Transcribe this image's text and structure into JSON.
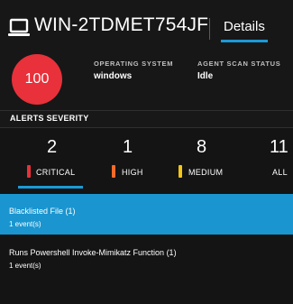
{
  "header": {
    "host_icon": "laptop-icon",
    "hostname": "WIN-2TDMET754JF",
    "details_tab": "Details",
    "risk_score": "100",
    "os_label": "OPERATING SYSTEM",
    "os_value": "windows",
    "scan_label": "AGENT SCAN STATUS",
    "scan_value": "Idle"
  },
  "severity": {
    "title": "ALERTS SEVERITY",
    "items": [
      {
        "count": "2",
        "label": "CRITICAL",
        "color": "#e8313a"
      },
      {
        "count": "1",
        "label": "HIGH",
        "color": "#f36a2b"
      },
      {
        "count": "8",
        "label": "MEDIUM",
        "color": "#f5c518"
      },
      {
        "count": "11",
        "label": "ALL",
        "color": ""
      }
    ],
    "selected": "CRITICAL"
  },
  "alerts": [
    {
      "title": "Blacklisted File (1)",
      "events": "1 event(s)",
      "selected": true
    },
    {
      "title": "Runs Powershell Invoke-Mimikatz Function (1)",
      "events": "1 event(s)",
      "selected": false
    }
  ],
  "colors": {
    "accent": "#1c9ad6",
    "selected_row": "#1a95cf",
    "critical": "#e8313a",
    "high": "#f36a2b",
    "medium": "#f5c518"
  }
}
